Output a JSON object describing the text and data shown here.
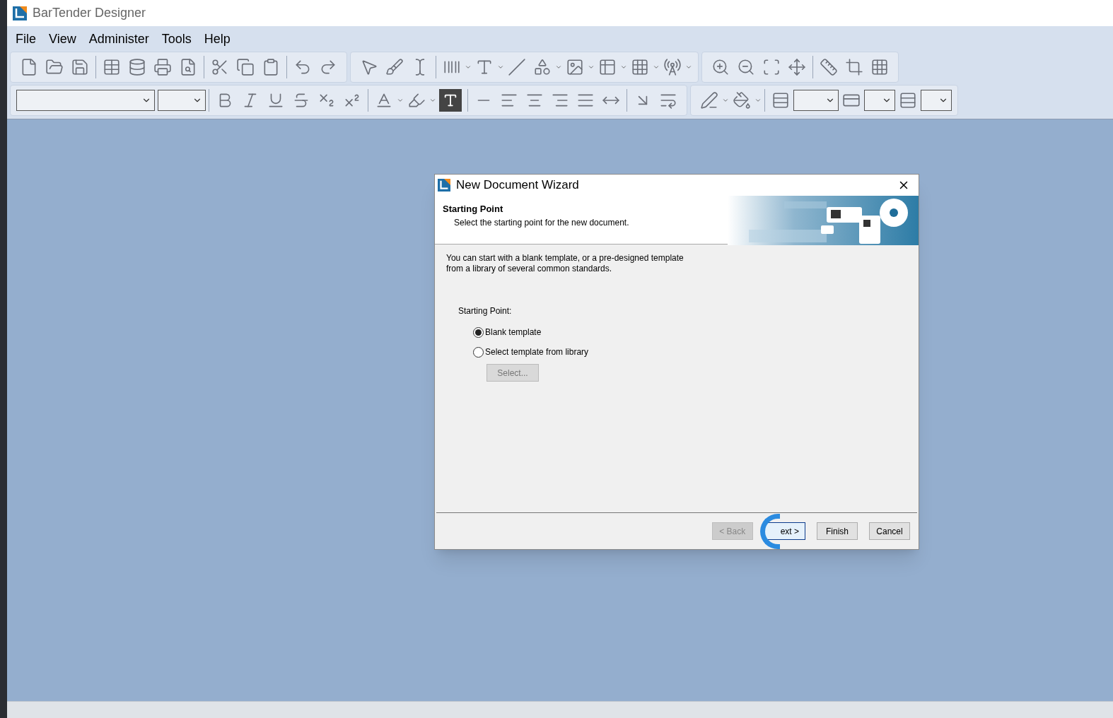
{
  "app": {
    "title": "BarTender Designer"
  },
  "menu": [
    {
      "label": "File"
    },
    {
      "label": "View"
    },
    {
      "label": "Administer"
    },
    {
      "label": "Tools"
    },
    {
      "label": "Help"
    }
  ],
  "dialog": {
    "title": "New Document Wizard",
    "header_title": "Starting Point",
    "header_subtitle": "Select the starting point for the new document.",
    "intro": "You can start with a blank template, or a pre-designed template from a library of several common standards.",
    "group_label": "Starting Point:",
    "options": [
      {
        "label": "Blank template",
        "selected": true
      },
      {
        "label": "Select template from library",
        "selected": false
      }
    ],
    "select_button": {
      "label": "Select...",
      "disabled": true
    },
    "buttons": [
      {
        "label": "< Back",
        "disabled": true,
        "focused": false
      },
      {
        "label": "ext >",
        "disabled": false,
        "focused": true
      },
      {
        "label": "Finish",
        "disabled": false,
        "focused": false
      },
      {
        "label": "Cancel",
        "disabled": false,
        "focused": false
      }
    ]
  }
}
